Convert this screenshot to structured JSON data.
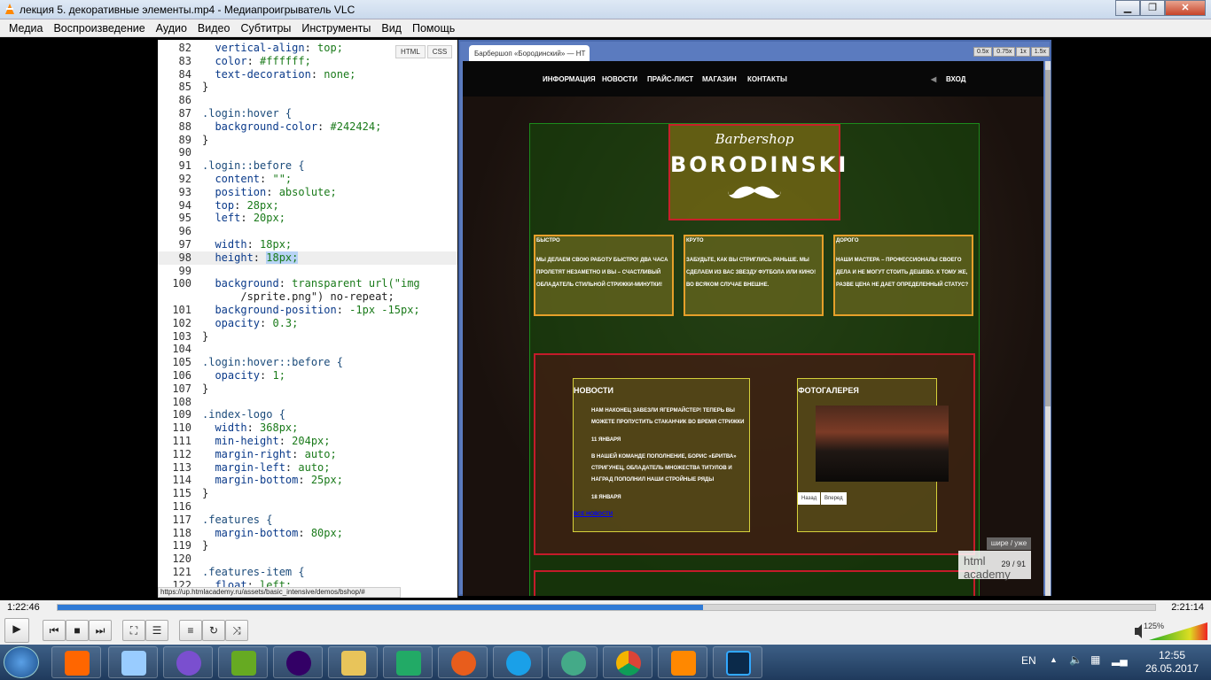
{
  "window": {
    "title": "лекция 5. декоративные элементы.mp4 - Медиапроигрыватель VLC",
    "btn_min": "▁",
    "btn_max": "❐",
    "btn_close": "✕"
  },
  "menu": [
    "Медиа",
    "Воспроизведение",
    "Аудио",
    "Видео",
    "Субтитры",
    "Инструменты",
    "Вид",
    "Помощь"
  ],
  "editor": {
    "tabs": [
      "HTML",
      "CSS"
    ],
    "lines": [
      {
        "n": "82",
        "t": "  vertical-align: top;"
      },
      {
        "n": "83",
        "t": "  color: #ffffff;"
      },
      {
        "n": "84",
        "t": "  text-decoration: none;"
      },
      {
        "n": "85",
        "t": "}"
      },
      {
        "n": "86",
        "t": ""
      },
      {
        "n": "87",
        "t": ".login:hover {"
      },
      {
        "n": "88",
        "t": "  background-color: #242424;"
      },
      {
        "n": "89",
        "t": "}"
      },
      {
        "n": "90",
        "t": ""
      },
      {
        "n": "91",
        "t": ".login::before {"
      },
      {
        "n": "92",
        "t": "  content: \"\";"
      },
      {
        "n": "93",
        "t": "  position: absolute;"
      },
      {
        "n": "94",
        "t": "  top: 28px;"
      },
      {
        "n": "95",
        "t": "  left: 20px;"
      },
      {
        "n": "96",
        "t": ""
      },
      {
        "n": "97",
        "t": "  width: 18px;"
      },
      {
        "n": "98",
        "t": "  height: 18px;"
      },
      {
        "n": "99",
        "t": ""
      },
      {
        "n": "100",
        "t": "  background: transparent url(\"img"
      },
      {
        "n": "",
        "t": "      /sprite.png\") no-repeat;"
      },
      {
        "n": "101",
        "t": "  background-position: -1px -15px;"
      },
      {
        "n": "102",
        "t": "  opacity: 0.3;"
      },
      {
        "n": "103",
        "t": "}"
      },
      {
        "n": "104",
        "t": ""
      },
      {
        "n": "105",
        "t": ".login:hover::before {"
      },
      {
        "n": "106",
        "t": "  opacity: 1;"
      },
      {
        "n": "107",
        "t": "}"
      },
      {
        "n": "108",
        "t": ""
      },
      {
        "n": "109",
        "t": ".index-logo {"
      },
      {
        "n": "110",
        "t": "  width: 368px;"
      },
      {
        "n": "111",
        "t": "  min-height: 204px;"
      },
      {
        "n": "112",
        "t": "  margin-right: auto;"
      },
      {
        "n": "113",
        "t": "  margin-left: auto;"
      },
      {
        "n": "114",
        "t": "  margin-bottom: 25px;"
      },
      {
        "n": "115",
        "t": "}"
      },
      {
        "n": "116",
        "t": ""
      },
      {
        "n": "117",
        "t": ".features {"
      },
      {
        "n": "118",
        "t": "  margin-bottom: 80px;"
      },
      {
        "n": "119",
        "t": "}"
      },
      {
        "n": "120",
        "t": ""
      },
      {
        "n": "121",
        "t": ".features-item {"
      },
      {
        "n": "122",
        "t": "  float: left;"
      }
    ],
    "status_url": "https://up.htmlacademy.ru/assets/basic_intensive/demos/bshop/#"
  },
  "browser": {
    "tab_title": "Барбершоп «Бородинский» — HT",
    "zoom": [
      "0.5x",
      "0.75x",
      "1x",
      "1.5x"
    ],
    "nav": [
      "ИНФОРМАЦИЯ",
      "НОВОСТИ",
      "ПРАЙС-ЛИСТ",
      "МАГАЗИН",
      "КОНТАКТЫ"
    ],
    "login": "ВХОД",
    "logo_script": "Barbershop",
    "logo_name": "BORODINSKI",
    "features": [
      {
        "h": "БЫСТРО",
        "t": "МЫ ДЕЛАЕМ СВОЮ РАБОТУ БЫСТРО! ДВА ЧАСА ПРОЛЕТЯТ НЕЗАМЕТНО И ВЫ – СЧАСТЛИВЫЙ ОБЛАДАТЕЛЬ СТИЛЬНОЙ СТРИЖКИ-МИНУТКИ!"
      },
      {
        "h": "КРУТО",
        "t": "ЗАБУДЬТЕ, КАК ВЫ СТРИГЛИСЬ РАНЬШЕ. МЫ СДЕЛАЕМ ИЗ ВАС ЗВЕЗДУ ФУТБОЛА ИЛИ КИНО! ВО ВСЯКОМ СЛУЧАЕ ВНЕШНЕ."
      },
      {
        "h": "ДОРОГО",
        "t": "НАШИ МАСТЕРА – ПРОФЕССИОНАЛЫ СВОЕГО ДЕЛА И НЕ МОГУТ СТОИТЬ ДЕШЕВО. К ТОМУ ЖЕ, РАЗВЕ ЦЕНА НЕ ДАЕТ ОПРЕДЕЛЕННЫЙ СТАТУС?"
      }
    ],
    "news_title": "НОВОСТИ",
    "news": [
      {
        "t": "НАМ НАКОНЕЦ ЗАВЕЗЛИ ЯГЕРМАЙСТЕР! ТЕПЕРЬ ВЫ МОЖЕТЕ ПРОПУСТИТЬ СТАКАНЧИК ВО ВРЕМЯ СТРИЖКИ",
        "d": "11 ЯНВАРЯ"
      },
      {
        "t": "В НАШЕЙ КОМАНДЕ ПОПОЛНЕНИЕ, БОРИС «БРИТВА» СТРИГУНЕЦ, ОБЛАДАТЕЛЬ МНОЖЕСТВА ТИТУЛОВ И НАГРАД ПОПОЛНИЛ НАШИ СТРОЙНЫЕ РЯДЫ",
        "d": "18 ЯНВАРЯ"
      }
    ],
    "all_news": "ВСЕ НОВОСТИ",
    "gallery_title": "ФОТОГАЛЕРЕЯ",
    "gallery_btns": [
      "Назад",
      "Вперед"
    ]
  },
  "overlay": {
    "wide": "шире / уже",
    "logo": "html academy",
    "counter": "29 / 91"
  },
  "player": {
    "elapsed": "1:22:46",
    "total": "2:21:14",
    "progress": 0.588,
    "volume_pct": "125%"
  },
  "taskbar": {
    "lang": "EN",
    "time": "12:55",
    "date": "26.05.2017"
  }
}
